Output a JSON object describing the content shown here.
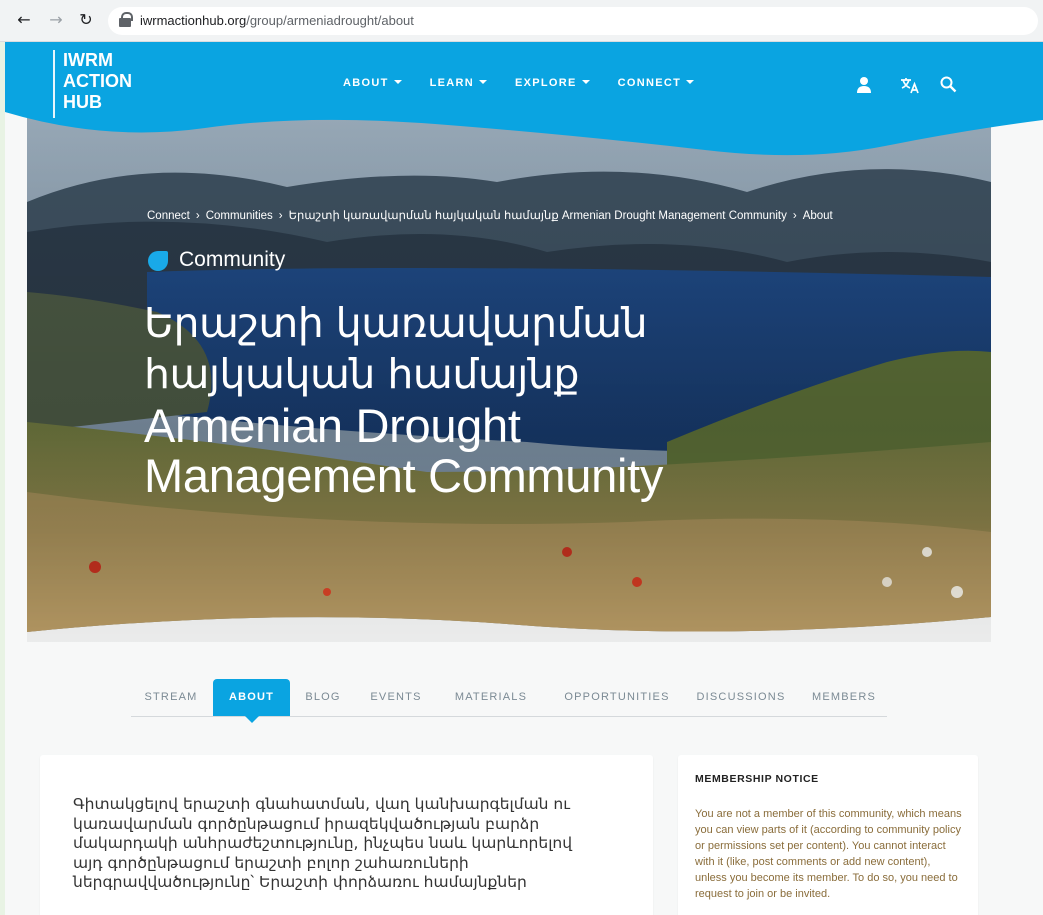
{
  "browser": {
    "url_domain": "iwrmactionhub.org",
    "url_path": "/group/armeniadrought/about"
  },
  "header": {
    "logo_lines": [
      "IWRM",
      "ACTION",
      "HUB"
    ],
    "nav": [
      {
        "label": "ABOUT"
      },
      {
        "label": "LEARN"
      },
      {
        "label": "EXPLORE"
      },
      {
        "label": "CONNECT"
      }
    ],
    "icons": [
      "user-icon",
      "translate-icon",
      "search-icon"
    ]
  },
  "hero": {
    "breadcrumbs": [
      "Connect",
      "Communities",
      "Երաշտի կառավարման հայկական համայնք Armenian Drought Management Community",
      "About"
    ],
    "tag": "Community",
    "title_am_line1": "Երաշտի կառավարման",
    "title_am_line2": "հայկական համայնք",
    "title_en_line1": "Armenian Drought",
    "title_en_line2": "Management Community"
  },
  "tabs": [
    {
      "label": "STREAM",
      "active": false
    },
    {
      "label": "ABOUT",
      "active": true
    },
    {
      "label": "BLOG",
      "active": false
    },
    {
      "label": "EVENTS",
      "active": false
    },
    {
      "label": "MATERIALS",
      "active": false
    },
    {
      "label": "OPPORTUNITIES",
      "active": false
    },
    {
      "label": "DISCUSSIONS",
      "active": false
    },
    {
      "label": "MEMBERS",
      "active": false
    }
  ],
  "main": {
    "body_lines": [
      "Գիտակցելով երաշտի գնահատման, վաղ կանխարգելման ու",
      "կառավարման գործընթացում իրազեկվածության բարձր",
      "մակարդակի անհրաժեշտությունը, ինչպես նաև կարևորելով",
      "այդ գործընթացում երաշտի բոլոր շահառուների",
      "ներգրավվածությունը՝ Երաշտի փորձառու համայնքներ"
    ]
  },
  "sidebar": {
    "heading": "MEMBERSHIP NOTICE",
    "notice": "You are not a member of this community, which means you can view parts of it (according to community policy or permissions set per content). You cannot interact with it (like, post comments or add new content), unless you become its member. To do so, you need to request to join or be invited."
  },
  "colors": {
    "brand_blue": "#0aa4e1",
    "notice_text": "#8a6d3b"
  }
}
